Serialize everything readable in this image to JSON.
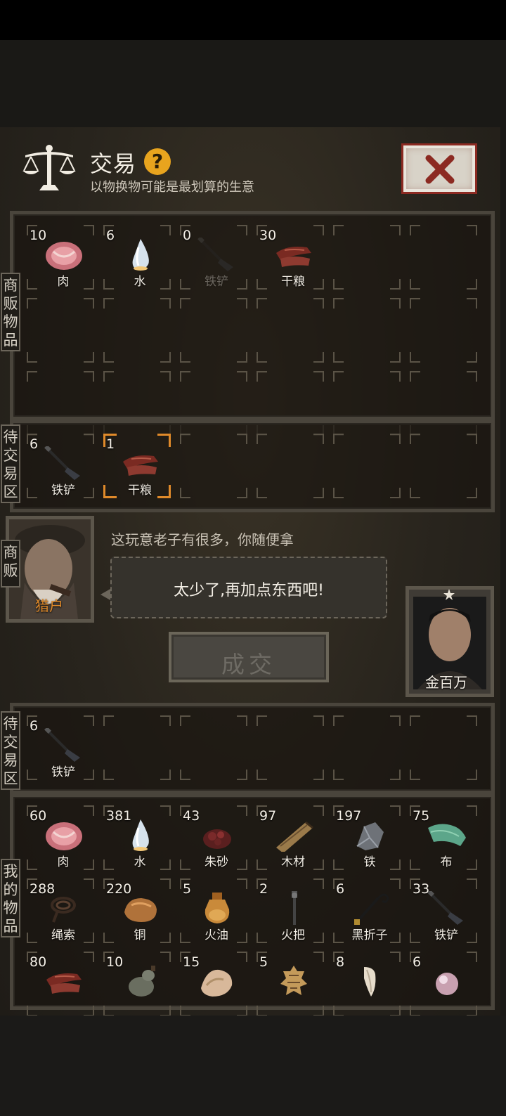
{
  "header": {
    "title": "交易",
    "help_label": "?",
    "subtitle": "以物换物可能是最划算的生意"
  },
  "side_labels": {
    "merchant_goods": "商\n贩\n物\n品",
    "merchant_pending": "待\n交\n易\n区",
    "merchant": "商\n贩",
    "my_pending": "待\n交\n易\n区",
    "my_goods": "我\n的\n物\n品"
  },
  "merchant_goods": [
    {
      "count": "10",
      "name": "肉",
      "icon": "meat-icon"
    },
    {
      "count": "6",
      "name": "水",
      "icon": "water-icon"
    },
    {
      "count": "0",
      "name": "铁铲",
      "icon": "shovel-icon",
      "dim": true
    },
    {
      "count": "30",
      "name": "干粮",
      "icon": "jerky-icon"
    }
  ],
  "merchant_pending": [
    {
      "count": "6",
      "name": "铁铲",
      "icon": "shovel-icon"
    },
    {
      "count": "1",
      "name": "干粮",
      "icon": "jerky-icon",
      "selected": true
    }
  ],
  "dialog": {
    "merchant_name": "猎户",
    "merchant_line": "这玩意老子有很多，你随便拿",
    "reply": "太少了,再加点东西吧!",
    "deal_button": "成交",
    "player_name": "金百万",
    "player_rank_icon": "star-icon"
  },
  "my_pending": [
    {
      "count": "6",
      "name": "铁铲",
      "icon": "shovel-icon"
    }
  ],
  "my_goods": [
    {
      "count": "60",
      "name": "肉",
      "icon": "meat-icon"
    },
    {
      "count": "381",
      "name": "水",
      "icon": "water-icon"
    },
    {
      "count": "43",
      "name": "朱砂",
      "icon": "cinnabar-icon"
    },
    {
      "count": "97",
      "name": "木材",
      "icon": "wood-icon"
    },
    {
      "count": "197",
      "name": "铁",
      "icon": "iron-icon"
    },
    {
      "count": "75",
      "name": "布",
      "icon": "cloth-icon"
    },
    {
      "count": "288",
      "name": "绳索",
      "icon": "rope-icon"
    },
    {
      "count": "220",
      "name": "铜",
      "icon": "copper-icon"
    },
    {
      "count": "5",
      "name": "火油",
      "icon": "oil-icon"
    },
    {
      "count": "2",
      "name": "火把",
      "icon": "torch-icon"
    },
    {
      "count": "6",
      "name": "黑折子",
      "icon": "hook-icon"
    },
    {
      "count": "33",
      "name": "铁铲",
      "icon": "shovel-icon"
    },
    {
      "count": "80",
      "name": "",
      "icon": "jerky-icon"
    },
    {
      "count": "10",
      "name": "",
      "icon": "gourd-icon"
    },
    {
      "count": "15",
      "name": "",
      "icon": "fur-icon"
    },
    {
      "count": "5",
      "name": "",
      "icon": "pelt-icon"
    },
    {
      "count": "8",
      "name": "",
      "icon": "fang-icon"
    },
    {
      "count": "6",
      "name": "",
      "icon": "pearl-icon"
    }
  ],
  "colors": {
    "accent_orange": "#e08a2a",
    "help_yellow": "#e8a41e",
    "close_red": "#8c2a22"
  }
}
